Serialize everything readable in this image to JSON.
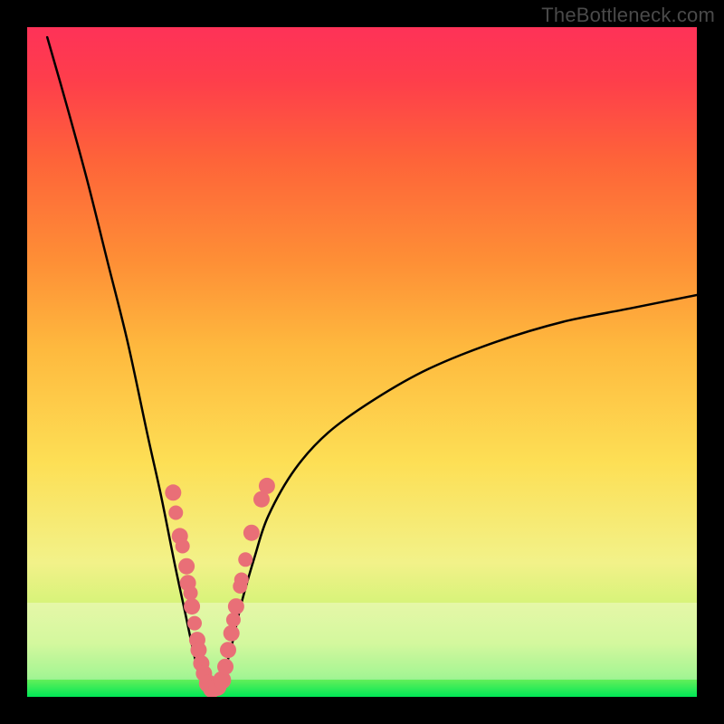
{
  "watermark": "TheBottleneck.com",
  "colors": {
    "frame": "#000000",
    "curve_stroke": "#000000",
    "blob_fill": "#e96f77",
    "gradient_stops": [
      "#fe3258",
      "#fe3e4b",
      "#fe6439",
      "#fe8f36",
      "#feb93e",
      "#fddf55",
      "#f2f289",
      "#bdf46a",
      "#74f05a",
      "#00e756"
    ]
  },
  "chart_data": {
    "type": "line",
    "title": "",
    "xlabel": "",
    "ylabel": "",
    "xlim": [
      0,
      1
    ],
    "ylim": [
      0,
      1
    ],
    "note": "Axes are unticked; values normalized to plot box. Curve resembles |x - x0|-like bottleneck with minimum near x≈0.27, y≈0; left branch steep toward y≈1 at x≈0.03, right branch rises to y≈0.60 at x≈1.",
    "series": [
      {
        "name": "bottleneck-curve",
        "points": [
          {
            "x": 0.03,
            "y": 0.985
          },
          {
            "x": 0.06,
            "y": 0.88
          },
          {
            "x": 0.09,
            "y": 0.77
          },
          {
            "x": 0.12,
            "y": 0.65
          },
          {
            "x": 0.15,
            "y": 0.53
          },
          {
            "x": 0.18,
            "y": 0.39
          },
          {
            "x": 0.2,
            "y": 0.3
          },
          {
            "x": 0.22,
            "y": 0.2
          },
          {
            "x": 0.235,
            "y": 0.13
          },
          {
            "x": 0.25,
            "y": 0.06
          },
          {
            "x": 0.26,
            "y": 0.025
          },
          {
            "x": 0.275,
            "y": 0.005
          },
          {
            "x": 0.29,
            "y": 0.025
          },
          {
            "x": 0.305,
            "y": 0.075
          },
          {
            "x": 0.32,
            "y": 0.14
          },
          {
            "x": 0.34,
            "y": 0.21
          },
          {
            "x": 0.36,
            "y": 0.27
          },
          {
            "x": 0.4,
            "y": 0.34
          },
          {
            "x": 0.45,
            "y": 0.395
          },
          {
            "x": 0.52,
            "y": 0.445
          },
          {
            "x": 0.6,
            "y": 0.49
          },
          {
            "x": 0.7,
            "y": 0.53
          },
          {
            "x": 0.8,
            "y": 0.56
          },
          {
            "x": 0.9,
            "y": 0.58
          },
          {
            "x": 1.0,
            "y": 0.6
          }
        ]
      }
    ],
    "blobs": {
      "name": "highlight-points",
      "note": "Pink dots clustered around the trough on both branches, normalized coords.",
      "points": [
        {
          "x": 0.218,
          "y": 0.305,
          "r": 9
        },
        {
          "x": 0.222,
          "y": 0.275,
          "r": 8
        },
        {
          "x": 0.228,
          "y": 0.24,
          "r": 9
        },
        {
          "x": 0.232,
          "y": 0.225,
          "r": 8
        },
        {
          "x": 0.238,
          "y": 0.195,
          "r": 9
        },
        {
          "x": 0.24,
          "y": 0.17,
          "r": 9
        },
        {
          "x": 0.244,
          "y": 0.155,
          "r": 8
        },
        {
          "x": 0.246,
          "y": 0.135,
          "r": 9
        },
        {
          "x": 0.25,
          "y": 0.11,
          "r": 8
        },
        {
          "x": 0.254,
          "y": 0.085,
          "r": 9
        },
        {
          "x": 0.256,
          "y": 0.07,
          "r": 9
        },
        {
          "x": 0.26,
          "y": 0.05,
          "r": 9
        },
        {
          "x": 0.264,
          "y": 0.035,
          "r": 9
        },
        {
          "x": 0.27,
          "y": 0.02,
          "r": 10
        },
        {
          "x": 0.276,
          "y": 0.012,
          "r": 10
        },
        {
          "x": 0.284,
          "y": 0.015,
          "r": 10
        },
        {
          "x": 0.291,
          "y": 0.025,
          "r": 10
        },
        {
          "x": 0.296,
          "y": 0.045,
          "r": 9
        },
        {
          "x": 0.3,
          "y": 0.07,
          "r": 9
        },
        {
          "x": 0.305,
          "y": 0.095,
          "r": 9
        },
        {
          "x": 0.308,
          "y": 0.115,
          "r": 8
        },
        {
          "x": 0.312,
          "y": 0.135,
          "r": 9
        },
        {
          "x": 0.318,
          "y": 0.165,
          "r": 8
        },
        {
          "x": 0.32,
          "y": 0.175,
          "r": 8
        },
        {
          "x": 0.326,
          "y": 0.205,
          "r": 8
        },
        {
          "x": 0.335,
          "y": 0.245,
          "r": 9
        },
        {
          "x": 0.35,
          "y": 0.295,
          "r": 9
        },
        {
          "x": 0.358,
          "y": 0.315,
          "r": 9
        }
      ]
    },
    "frosted_band": {
      "y_bottom": 0.025,
      "y_top": 0.14
    }
  }
}
